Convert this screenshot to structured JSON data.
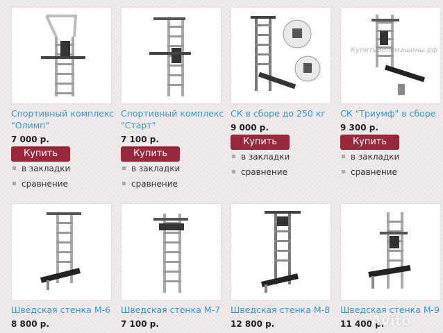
{
  "products": [
    {
      "title_line1": "Спортивный комплекс",
      "title_line2": "\"Олимп\"",
      "price": "7 000 р.",
      "buy": "Купить",
      "bookmark": "в закладки",
      "compare": "сравнение",
      "image_icon": "wall-bars-pullup-icon"
    },
    {
      "title_line1": "Спортивный комплекс",
      "title_line2": "\"Старт\"",
      "price": "7 100 р.",
      "buy": "Купить",
      "bookmark": "в закладки",
      "compare": "сравнение",
      "image_icon": "wall-bars-pullup-icon"
    },
    {
      "title_line1": "СК в сборе до 250 кг",
      "title_line2": "",
      "price": "9 000 р.",
      "buy": "Купить",
      "bookmark": "в закладки",
      "compare": "сравнение",
      "image_icon": "wall-bars-bench-icon"
    },
    {
      "title_line1": "СК \"Триумф\" в сборе",
      "title_line2": "",
      "price": "9 300 р.",
      "buy": "Купить",
      "bookmark": "в закладки",
      "compare": "сравнение",
      "image_icon": "wall-bars-bench-icon",
      "image_watermark": "КупитьВеломашины.рф"
    },
    {
      "title_line1": "Шведская стенка М-6",
      "title_line2": "",
      "price": "8 800 р.",
      "image_icon": "wall-bars-bench-icon"
    },
    {
      "title_line1": "Шведская стенка М-7",
      "title_line2": "",
      "price": "7 100 р.",
      "image_icon": "wall-bars-pullup-icon"
    },
    {
      "title_line1": "Шведская стенка М-8",
      "title_line2": "",
      "price": "12 800 р.",
      "image_icon": "wall-bars-bench-icon"
    },
    {
      "title_line1": "Шведская стенка М-9",
      "title_line2": "",
      "price": "11 400 р.",
      "image_icon": "wall-bars-bench-icon"
    }
  ],
  "watermark": "Avito",
  "colors": {
    "link": "#2a9ad6",
    "buy_button": "#97283a",
    "thumb_border": "#e3dddd"
  }
}
